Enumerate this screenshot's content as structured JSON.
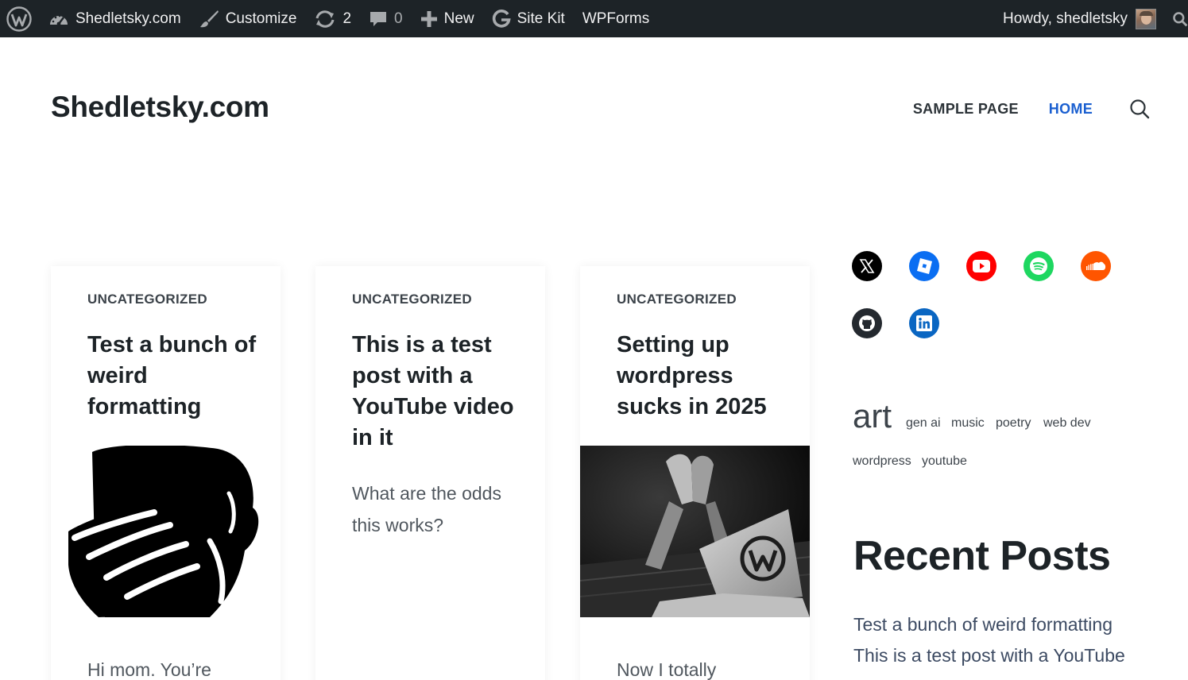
{
  "admin_bar": {
    "site_name": "Shedletsky.com",
    "customize": "Customize",
    "updates_count": "2",
    "comments_count": "0",
    "new": "New",
    "site_kit": "Site Kit",
    "wpforms": "WPForms",
    "howdy": "Howdy, shedletsky"
  },
  "header": {
    "site_title": "Shedletsky.com",
    "nav": [
      {
        "label": "SAMPLE PAGE",
        "current": false
      },
      {
        "label": "HOME",
        "current": true
      }
    ]
  },
  "posts": [
    {
      "category": "UNCATEGORIZED",
      "title": "Test a bunch of weird formatting",
      "excerpt": "Hi mom. You’re",
      "image": "facepalm-icon"
    },
    {
      "category": "UNCATEGORIZED",
      "title": "This is a test post with a YouTube video in it",
      "excerpt": "What are the odds this works?"
    },
    {
      "category": "UNCATEGORIZED",
      "title": "Setting up wordpress sucks in 2025",
      "excerpt": "Now I totally",
      "image": "frustrated-laptop-photo"
    }
  ],
  "sidebar": {
    "social": [
      {
        "icon": "x-icon",
        "color": "#000000"
      },
      {
        "icon": "roblox-icon",
        "color": "#0a6ef2"
      },
      {
        "icon": "youtube-icon",
        "color": "#ff0000"
      },
      {
        "icon": "spotify-icon",
        "color": "#1ed760"
      },
      {
        "icon": "soundcloud-icon",
        "color": "#ff5500"
      },
      {
        "icon": "github-icon",
        "color": "#24292f"
      },
      {
        "icon": "linkedin-icon",
        "color": "#0a66c2"
      }
    ],
    "tags": [
      "art",
      "gen ai",
      "music",
      "poetry",
      "web dev",
      "wordpress",
      "youtube"
    ],
    "recent_posts_title": "Recent Posts",
    "recent_posts": [
      "Test a bunch of weird formatting",
      "This is a test post with a YouTube"
    ]
  },
  "colors": {
    "admin_bar_bg": "#1d2327",
    "nav_current": "#1a5fd0"
  }
}
